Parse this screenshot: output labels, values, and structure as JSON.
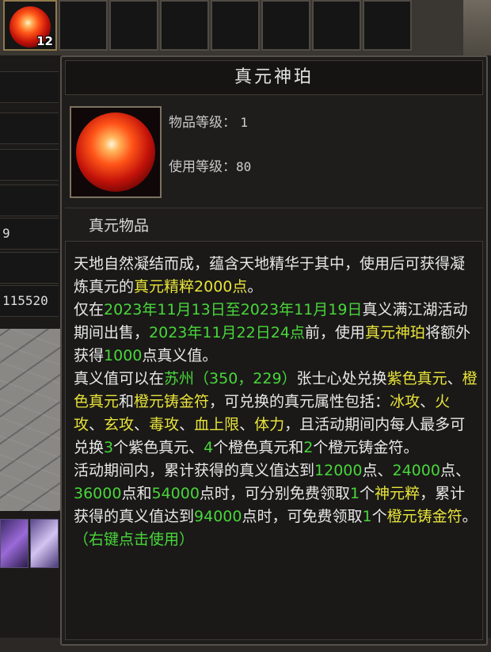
{
  "inventory": {
    "first_slot_count": "12"
  },
  "left_panel": {
    "row_value_1": "9",
    "row_value_2": "115520"
  },
  "tooltip": {
    "title": "真元神珀",
    "item_level_label": "物品等级：",
    "item_level_value": "1",
    "use_level_label": "使用等级：",
    "use_level_value": "80",
    "item_type": "真元物品",
    "description": [
      [
        {
          "t": "天地自然凝结而成，蕴含天地精华于其中，使用后可获得凝炼真元的",
          "c": "w"
        },
        {
          "t": "真元精粹",
          "c": "y"
        },
        {
          "t": "2000点",
          "c": "y"
        },
        {
          "t": "。",
          "c": "w"
        }
      ],
      [
        {
          "t": "仅在",
          "c": "w"
        },
        {
          "t": "2023年11月13日至2023年11月19日",
          "c": "g"
        },
        {
          "t": "真义满江湖活动期间出售，",
          "c": "w"
        },
        {
          "t": "2023年11月22日24点",
          "c": "g"
        },
        {
          "t": "前，使用",
          "c": "w"
        },
        {
          "t": "真元神珀",
          "c": "y"
        },
        {
          "t": "将额外获得",
          "c": "w"
        },
        {
          "t": "1000",
          "c": "g"
        },
        {
          "t": "点真义值。",
          "c": "w"
        }
      ],
      [
        {
          "t": "真义值可以在",
          "c": "w"
        },
        {
          "t": "苏州（350，229）",
          "c": "g"
        },
        {
          "t": "张士心处兑换",
          "c": "w"
        },
        {
          "t": "紫色真元",
          "c": "y"
        },
        {
          "t": "、",
          "c": "w"
        },
        {
          "t": "橙色真元",
          "c": "y"
        },
        {
          "t": "和",
          "c": "w"
        },
        {
          "t": "橙元铸金符",
          "c": "y"
        },
        {
          "t": "，可兑换的真元属性包括：",
          "c": "w"
        },
        {
          "t": "冰攻",
          "c": "y"
        },
        {
          "t": "、",
          "c": "w"
        },
        {
          "t": "火攻",
          "c": "y"
        },
        {
          "t": "、",
          "c": "w"
        },
        {
          "t": "玄攻",
          "c": "y"
        },
        {
          "t": "、",
          "c": "w"
        },
        {
          "t": "毒攻",
          "c": "y"
        },
        {
          "t": "、",
          "c": "w"
        },
        {
          "t": "血上限",
          "c": "y"
        },
        {
          "t": "、",
          "c": "w"
        },
        {
          "t": "体力",
          "c": "y"
        },
        {
          "t": "，且活动期间内每人最多可兑换",
          "c": "w"
        },
        {
          "t": "3",
          "c": "g"
        },
        {
          "t": "个紫色真元、",
          "c": "w"
        },
        {
          "t": "4",
          "c": "g"
        },
        {
          "t": "个橙色真元和",
          "c": "w"
        },
        {
          "t": "2",
          "c": "g"
        },
        {
          "t": "个橙元铸金符。",
          "c": "w"
        }
      ],
      [
        {
          "t": "活动期间内，累计获得的真义值达到",
          "c": "w"
        },
        {
          "t": "12000",
          "c": "g"
        },
        {
          "t": "点、",
          "c": "w"
        },
        {
          "t": "24000",
          "c": "g"
        },
        {
          "t": "点、",
          "c": "w"
        },
        {
          "t": "36000",
          "c": "g"
        },
        {
          "t": "点和",
          "c": "w"
        },
        {
          "t": "54000",
          "c": "g"
        },
        {
          "t": "点时，可分别免费领取",
          "c": "w"
        },
        {
          "t": "1",
          "c": "g"
        },
        {
          "t": "个",
          "c": "w"
        },
        {
          "t": "神元粹",
          "c": "y"
        },
        {
          "t": "，累计获得的真义值达到",
          "c": "w"
        },
        {
          "t": "94000",
          "c": "g"
        },
        {
          "t": "点时，可免费领取",
          "c": "w"
        },
        {
          "t": "1",
          "c": "g"
        },
        {
          "t": "个",
          "c": "w"
        },
        {
          "t": "橙元铸金符",
          "c": "y"
        },
        {
          "t": "。",
          "c": "w"
        }
      ],
      [
        {
          "t": "（右键点击使用）",
          "c": "g"
        }
      ]
    ]
  },
  "colors": {
    "highlight_yellow": "#e8e33a",
    "highlight_green": "#49d63a",
    "text_white": "#e8e8e8"
  },
  "icons": {
    "item_icon": "red-fire-orb-icon"
  }
}
